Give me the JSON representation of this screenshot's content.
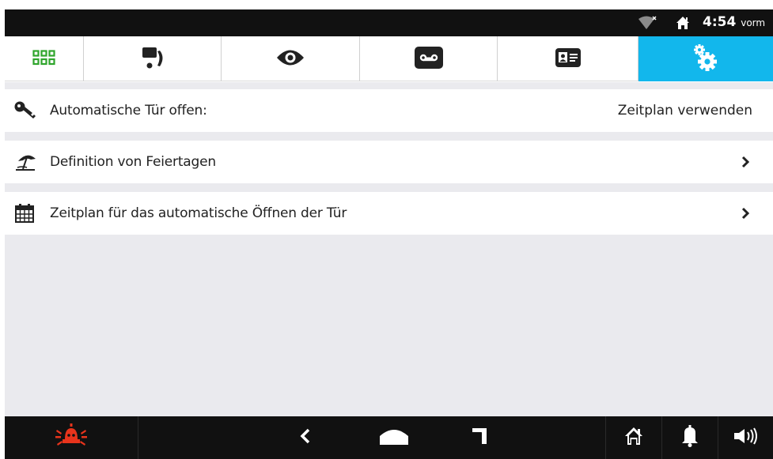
{
  "status_bar": {
    "time": "4:54",
    "ampm": "vorm",
    "icons": [
      "wifi-off-icon",
      "home-icon"
    ]
  },
  "tabs": [
    {
      "name": "apps",
      "icon": "grid-icon",
      "active": false
    },
    {
      "name": "intercom",
      "icon": "intercom-phone-icon",
      "active": false
    },
    {
      "name": "view",
      "icon": "eye-icon",
      "active": false
    },
    {
      "name": "voicemail",
      "icon": "voicemail-icon",
      "active": false
    },
    {
      "name": "contacts",
      "icon": "contact-card-icon",
      "active": false
    },
    {
      "name": "settings",
      "icon": "gears-icon",
      "active": true
    }
  ],
  "rows": [
    {
      "icon": "key-icon",
      "label": "Automatische Tür offen:",
      "value": "Zeitplan verwenden"
    },
    {
      "icon": "beach-umbrella-icon",
      "label": "Definition von Feiertagen",
      "chevron": true
    },
    {
      "icon": "calendar-icon",
      "label": "Zeitplan für das automatische Öffnen der Tür",
      "chevron": true
    }
  ],
  "bottom_bar": {
    "icons": [
      "alarm-siren-icon",
      "back-icon",
      "home-nav-icon",
      "recent-apps-icon",
      "house-icon",
      "bell-icon",
      "speaker-icon"
    ],
    "colors": {
      "alarm": "#e8341c",
      "active_tab": "#12b7ec",
      "apps_icon": "#2fa52c"
    }
  }
}
